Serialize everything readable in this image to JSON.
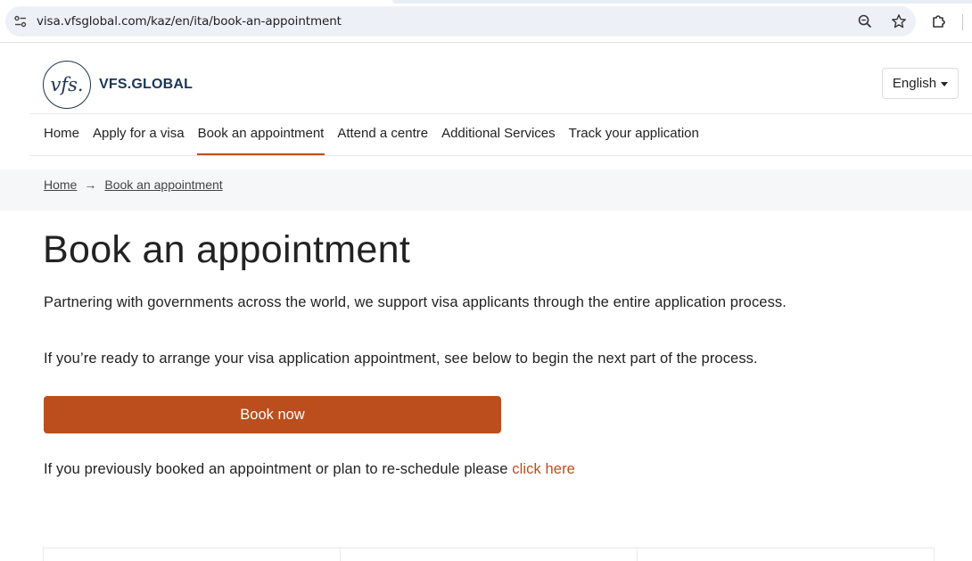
{
  "browser": {
    "url": "visa.vfsglobal.com/kaz/en/ita/book-an-appointment"
  },
  "header": {
    "logo_mark": "vfs.",
    "logo_text": "VFS.GLOBAL",
    "language": "English"
  },
  "nav": {
    "items": [
      {
        "label": "Home"
      },
      {
        "label": "Apply for a visa"
      },
      {
        "label": "Book an appointment"
      },
      {
        "label": "Attend a centre"
      },
      {
        "label": "Additional Services"
      },
      {
        "label": "Track your application"
      }
    ],
    "active_index": 2
  },
  "breadcrumb": {
    "home": "Home",
    "arrow": "→",
    "current": "Book an appointment"
  },
  "main": {
    "title": "Book an appointment",
    "para1": "Partnering with governments across the world, we support visa applicants through the entire application process.",
    "para2": "If you’re ready to arrange your visa application appointment, see below to begin the next part of the process.",
    "book_button": "Book now",
    "para3_text": "If you previously booked an appointment or plan to re-schedule please ",
    "para3_link": "click here"
  },
  "colors": {
    "accent": "#bc4e1d",
    "brand_navy": "#1d3557"
  }
}
